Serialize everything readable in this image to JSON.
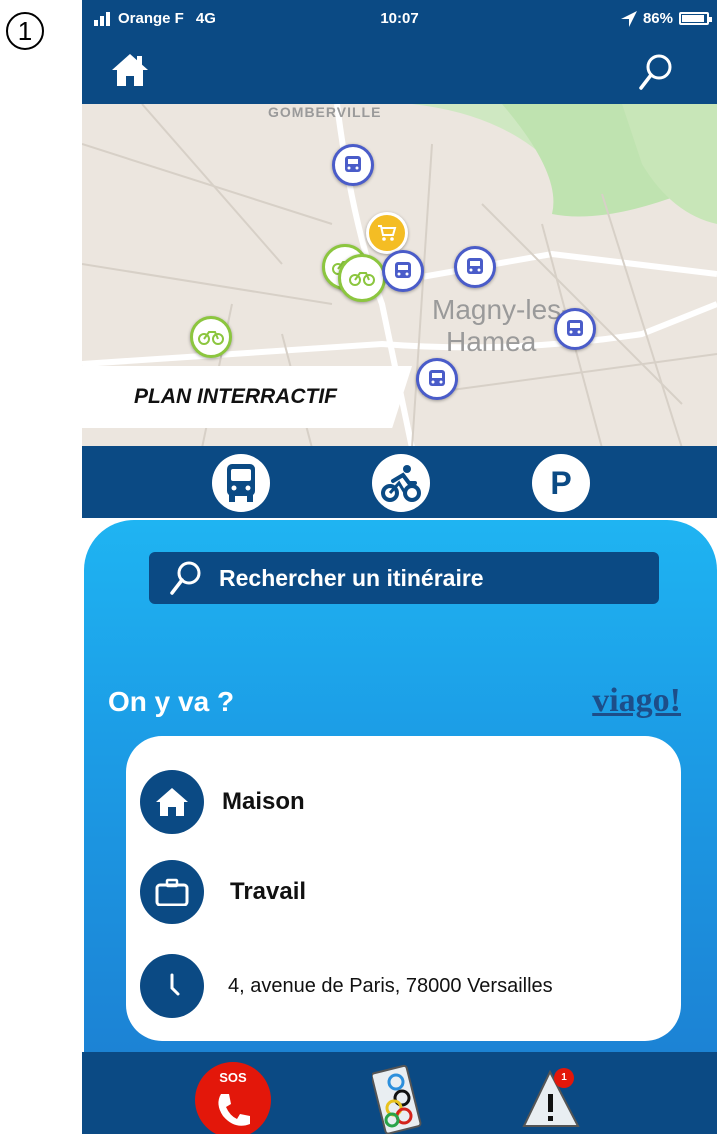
{
  "step_number": "1",
  "status_bar": {
    "carrier": "Orange F",
    "network": "4G",
    "time": "10:07",
    "battery": "86%",
    "battery_level": 0.86
  },
  "map": {
    "locality_top": "GOMBERVILLE",
    "town_line1": "Magny-les-",
    "town_line2": "Hamea",
    "plan_button": "PLAN INTERRACTIF"
  },
  "modes": [
    {
      "icon": "bus-icon"
    },
    {
      "icon": "bike-icon"
    },
    {
      "label": "P",
      "icon": "parking-icon"
    }
  ],
  "search": {
    "label": "Rechercher un itinéraire"
  },
  "headline": "On y va ?",
  "brand": "viago!",
  "favorites": [
    {
      "icon": "home-icon",
      "label": "Maison"
    },
    {
      "icon": "briefcase-icon",
      "label": "Travail"
    },
    {
      "icon": "clock-icon",
      "label": "4, avenue de Paris, 78000 Versailles"
    }
  ],
  "bottom_nav": {
    "sos_label": "SOS",
    "alert_count": "1"
  },
  "colors": {
    "primary": "#0b4a84",
    "panel": "#1fb4f2",
    "sos": "#e3170a",
    "bike": "#8cc63f",
    "bus": "#4a5cc9"
  }
}
